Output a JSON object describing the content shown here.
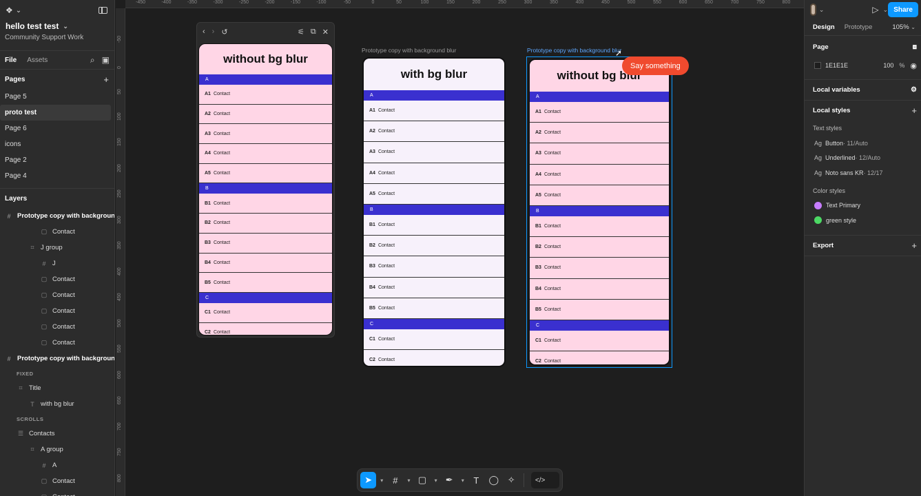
{
  "file": {
    "title": "hello test test",
    "team": "Community Support Work"
  },
  "left_tabs": [
    "File",
    "Assets"
  ],
  "pages_header": "Pages",
  "pages": [
    "Page 5",
    "proto test",
    "Page 6",
    "icons",
    "Page 2",
    "Page 4"
  ],
  "selected_page": "proto test",
  "layers_header": "Layers",
  "layers": [
    {
      "label": "Prototype copy with background ...",
      "indent": 0,
      "icon": "#",
      "bold": true
    },
    {
      "label": "Contact",
      "indent": 3,
      "icon": "▢"
    },
    {
      "label": "J group",
      "indent": 2,
      "icon": "⌗"
    },
    {
      "label": "J",
      "indent": 3,
      "icon": "#"
    },
    {
      "label": "Contact",
      "indent": 3,
      "icon": "▢"
    },
    {
      "label": "Contact",
      "indent": 3,
      "icon": "▢"
    },
    {
      "label": "Contact",
      "indent": 3,
      "icon": "▢"
    },
    {
      "label": "Contact",
      "indent": 3,
      "icon": "▢"
    },
    {
      "label": "Contact",
      "indent": 3,
      "icon": "▢"
    },
    {
      "label": "Prototype copy with background blur",
      "indent": 0,
      "icon": "#",
      "bold": true
    },
    {
      "caption": "FIXED"
    },
    {
      "label": "Title",
      "indent": 1,
      "icon": "⌗"
    },
    {
      "label": "with bg blur",
      "indent": 2,
      "icon": "T"
    },
    {
      "caption": "SCROLLS"
    },
    {
      "label": "Contacts",
      "indent": 1,
      "icon": "☰"
    },
    {
      "label": "A group",
      "indent": 2,
      "icon": "⌗"
    },
    {
      "label": "A",
      "indent": 3,
      "icon": "#"
    },
    {
      "label": "Contact",
      "indent": 3,
      "icon": "▢"
    },
    {
      "label": "Contact",
      "indent": 3,
      "icon": "▢"
    }
  ],
  "ruler_top": [
    "-450",
    "-400",
    "-350",
    "-300",
    "-250",
    "-200",
    "-150",
    "-100",
    "-50",
    "0",
    "50",
    "100",
    "150",
    "200",
    "250",
    "300",
    "350",
    "400",
    "450",
    "500",
    "550",
    "600",
    "650",
    "700",
    "750",
    "800"
  ],
  "ruler_left": [
    "-50",
    "0",
    "50",
    "100",
    "150",
    "200",
    "250",
    "300",
    "350",
    "400",
    "450",
    "500",
    "550",
    "600",
    "650",
    "700",
    "750",
    "800"
  ],
  "frames": {
    "label_middle": "Prototype copy with background blur",
    "label_right": "Prototype copy with background blur",
    "title_preview": "without bg blur",
    "title_middle": "with bg blur",
    "title_right": "without bg blur"
  },
  "contact_word": "Contact",
  "sections": [
    {
      "letter": "A",
      "ids": [
        "A1",
        "A2",
        "A3",
        "A4",
        "A5"
      ]
    },
    {
      "letter": "B",
      "ids": [
        "B1",
        "B2",
        "B3",
        "B4",
        "B5"
      ]
    },
    {
      "letter": "C",
      "ids": [
        "C1",
        "C2"
      ]
    }
  ],
  "comment_bubble": "Say something",
  "right_panel": {
    "share": "Share",
    "tabs": [
      "Design",
      "Prototype"
    ],
    "zoom": "105%",
    "page_header": "Page",
    "page_color": "1E1E1E",
    "page_opacity": "100",
    "page_opacity_unit": "%",
    "local_variables": "Local variables",
    "local_styles": "Local styles",
    "text_styles_header": "Text styles",
    "text_styles": [
      {
        "ag": "Ag",
        "name": "Button",
        "meta": " · 11/Auto"
      },
      {
        "ag": "Ag",
        "name": "Underlined",
        "meta": " · 12/Auto"
      },
      {
        "ag": "Ag",
        "name": "Noto sans KR",
        "meta": " · 12/17"
      }
    ],
    "color_styles_header": "Color styles",
    "color_styles": [
      {
        "name": "Text Primary",
        "color": "#c77dff"
      },
      {
        "name": "green style",
        "color": "#4cd964"
      }
    ],
    "export": "Export"
  },
  "colors": {
    "accent": "#0d99ff",
    "section_bar": "#3a30cf",
    "pink_bg": "#ffd6e6",
    "lavender_bg": "#f7f1fb",
    "comment": "#f04a2e"
  }
}
